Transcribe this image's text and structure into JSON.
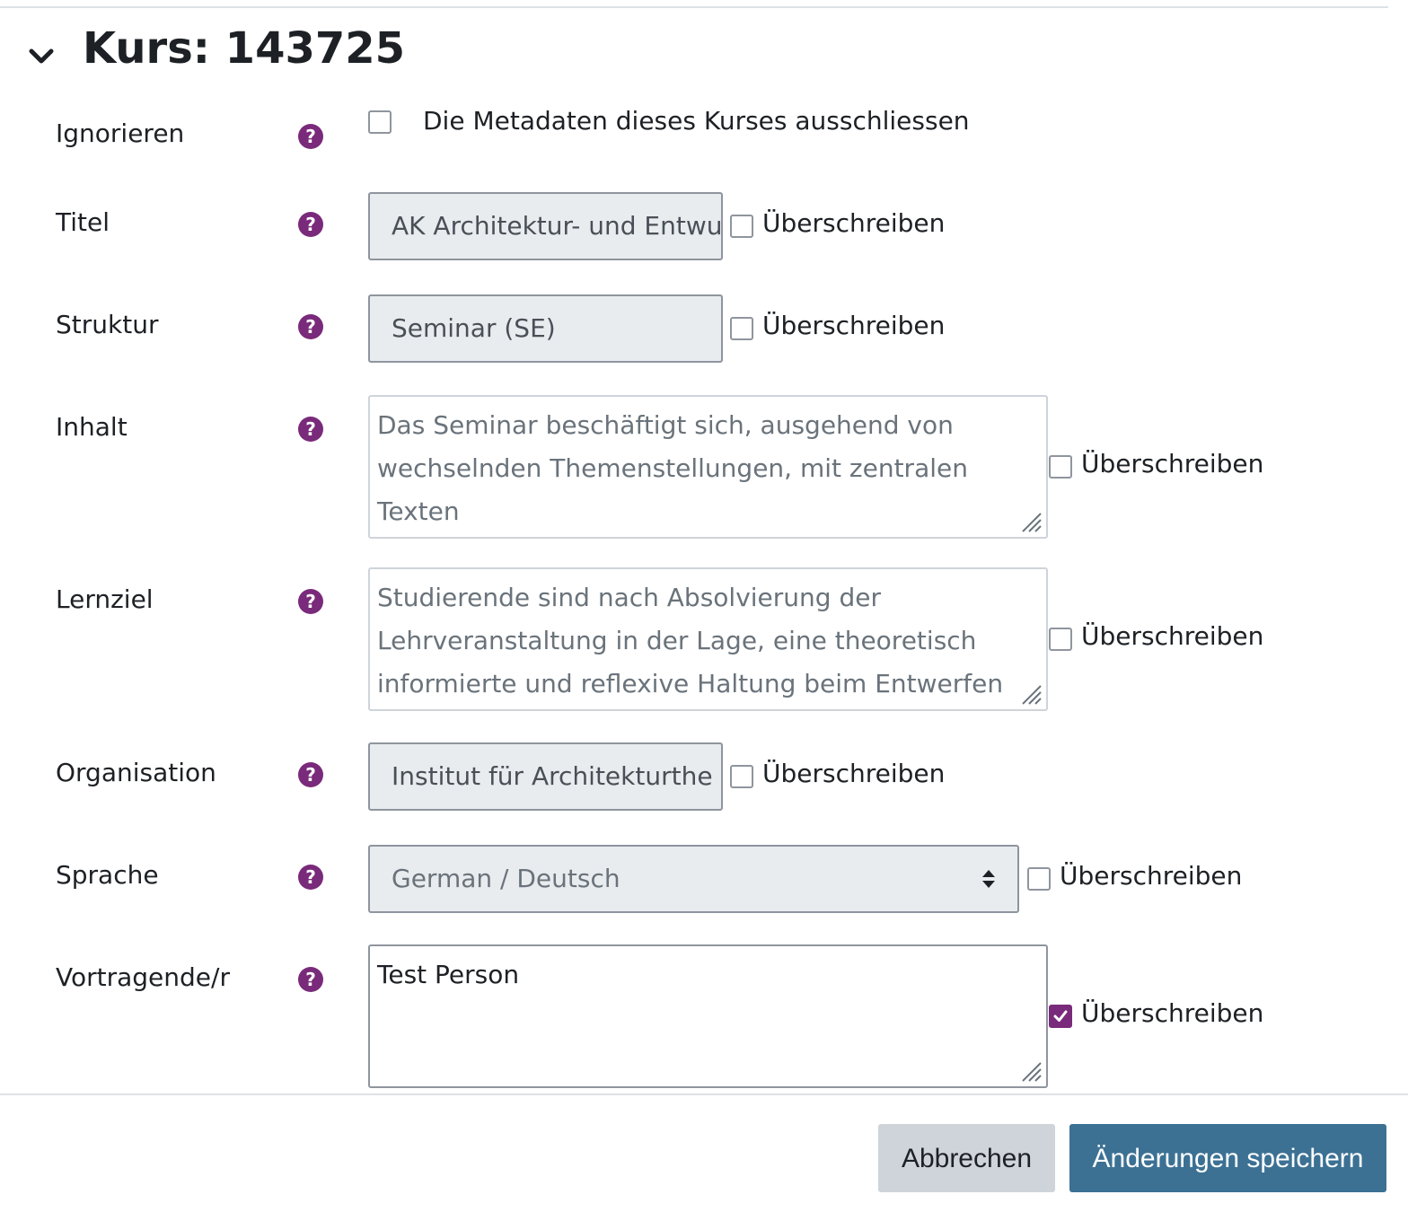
{
  "section": {
    "title": "Kurs: 143725",
    "collapse_icon": "chevron-down-icon"
  },
  "help_icon": "question-circle-icon",
  "accent_color": "#7a2a7a",
  "ignore": {
    "label": "Ignorieren",
    "checkbox_label": "Die Metadaten dieses Kurses ausschliessen",
    "checked": false
  },
  "fields": {
    "titel": {
      "label": "Titel",
      "value": "AK Architektur- und Entwu",
      "override_label": "Überschreiben",
      "override_checked": false
    },
    "struktur": {
      "label": "Struktur",
      "value": "Seminar (SE)",
      "override_label": "Überschreiben",
      "override_checked": false
    },
    "inhalt": {
      "label": "Inhalt",
      "value": "Das Seminar beschäftigt sich, ausgehend von\nwechselnden Themenstellungen, mit zentralen Texten\nder aktuellen und historischen Architektur- und",
      "override_label": "Überschreiben",
      "override_checked": false
    },
    "lernziel": {
      "label": "Lernziel",
      "value": "Studierende sind nach Absolvierung der\nLehrveranstaltung in der Lage, eine theoretisch\ninformierte und reflexive Haltung beim Entwerfen und",
      "override_label": "Überschreiben",
      "override_checked": false
    },
    "organisation": {
      "label": "Organisation",
      "value": "Institut für Architekturthe",
      "override_label": "Überschreiben",
      "override_checked": false
    },
    "sprache": {
      "label": "Sprache",
      "selected": "German / Deutsch",
      "override_label": "Überschreiben",
      "override_checked": false
    },
    "vortragende": {
      "label": "Vortragende/r",
      "value": "Test Person",
      "override_label": "Überschreiben",
      "override_checked": true
    }
  },
  "buttons": {
    "cancel": "Abbrechen",
    "save": "Änderungen speichern"
  }
}
